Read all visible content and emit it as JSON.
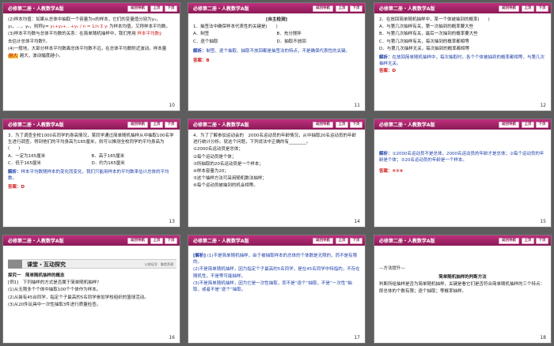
{
  "header": {
    "title": "必修第二册・人教数学A版",
    "main_nav": "返回导航",
    "prev": "上页",
    "next": "下页"
  },
  "slides": [
    {
      "page": "10",
      "lines": [
        "(2)样本均值：如果从总体中抽取一个容量为n的样本，它们的变量值分别为y₁，",
        "y₂，…，yₙ，则称ȳ=",
        "为样本均值，又称样本平均数。",
        "(3)样本平均数与总体平均数的关系：在简单随机抽样中，我们常用",
        "去估计总体平均数Ȳ。",
        "(4)一般地，大部分样本平均数离总体平均数不远，在总体平均数附近波动。样本量",
        "越大，波动幅度越小。"
      ],
      "formula": "y₁+y₂+…+yₙ / n = 1/n Σ yᵢ",
      "blank": "样本平均数ȳ",
      "highlight": "越大"
    },
    {
      "page": "11",
      "section": "[自主检测]",
      "question": "1．抽签法中确保样本代表性的关键是(　　)",
      "options": [
        "A．制签",
        "B．充分搅拌",
        "C．逐个抽取",
        "D．抽取不放回"
      ],
      "analysis_label": "解析：",
      "analysis": "制签、逐个抽取、抽取不放回都是抽签法的特点，不是确保代表性的关键。",
      "answer_label": "答案：",
      "answer": "B"
    },
    {
      "page": "12",
      "question": "2．在放回简单随机抽样中，某一个体被抽到的概率(　　)",
      "options": [
        "A．与第几次抽样有关，第一次抽到的概率要大些",
        "B．与第几次抽样有关，最后一次抽到的概率要大些",
        "C．与第几次抽样有关，每次抽到的概率都相等",
        "D．与第几次抽样无关，每次抽到的概率都相等"
      ],
      "analysis_label": "解析：",
      "analysis": "在放回简单随机抽样中，每次抽取时，各个个体被抽到的概率都相等，与第几次抽样无关。",
      "answer_label": "答案：",
      "answer": "D"
    },
    {
      "page": "13",
      "question": "3．为了调查全校1000名同学的身高情况，某同学通过简单随机抽样从中抽取100名学生进行调查，得到他们的平均身高为165厘米，则可以推测全校同学的平均身高为(　　)",
      "options": [
        "A．一定为165厘米",
        "B．高于165厘米",
        "C．低于165厘米",
        "D．约为165厘米"
      ],
      "analysis_label": "解析：",
      "analysis": "样本平均数随样本的变化而变化，我们只能用样本的平均数来估计总体的平均数。",
      "answer_label": "答案：",
      "answer": "D"
    },
    {
      "page": "14",
      "question": "4．为了了解参加运动会的　2000名运动员的年龄情况，从中抽取20名运动员的年龄进行统计分析。就这个问题，下列说法中正确的有________。",
      "statements": [
        "①2000名运动员是总体；",
        "②每个运动员是个体；",
        "③所抽取的20名运动员是一个样本；",
        "④样本容量为20；",
        "⑤这个抽样方法可采用随机数法抽样；",
        "⑥每个运动员被抽到的机会相等。"
      ]
    },
    {
      "page": "15",
      "analysis_label": "解析：",
      "analysis": "①2000名运动员不是总体，2000名运动员的年龄才是总体；②每个运动员的年龄是个体；③20名运动员的年龄是一个样本。",
      "answer_label": "答案：",
      "answer": "④⑤⑥"
    },
    {
      "page": "16",
      "section_title": "课堂・互动探究",
      "section_right": "以练促学　触类旁通",
      "topic": "探究一　简单随机抽样的概念",
      "example": "[例1]　下列抽样的方式是否属于简单随机抽样?",
      "items": [
        "(1)从无限多个个体中抽取100个个体作为样本。",
        "(2)从装有45台同学，指定个子最高的5名同学参加学校组织的篮球活动。",
        "(3)从20件玩具中一次性抽取3件进行质量检查。"
      ]
    },
    {
      "page": "17",
      "label": "[解析]",
      "lines": [
        "(1)不是简单随机抽样，由于被抽取样本的总体的个体数是无限的，而不是有限的。",
        "(2)不是简单随机抽样，因为指定个子最高的5名同学，是在45名同学中特指的，不存在随机性，不是等可能抽样。",
        "(3)不是简单随机抽样，因为它是一次性抽取，而不是“逐个”抽取，不是“一次性”抽取，或者不是“逐个”抽取。"
      ]
    },
    {
      "page": "18",
      "tip": "—方法提升—",
      "heading": "简单随机抽样的判断方法",
      "text": "判断所给抽样是否为简单随机抽样，关键是看它们是否符合简单随机抽样的三个特点：即总体的个数有限；逐个抽取；等概率抽样。"
    }
  ]
}
